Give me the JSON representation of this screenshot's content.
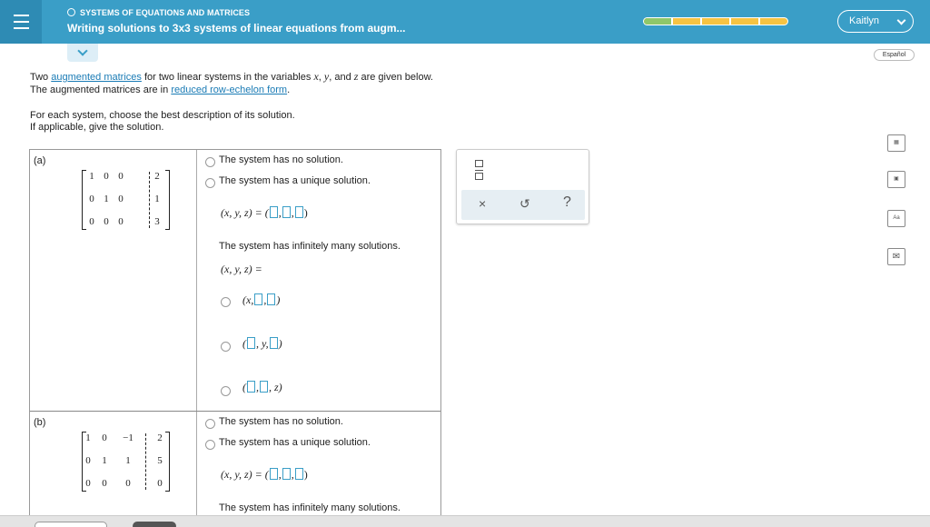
{
  "header": {
    "topic": "SYSTEMS OF EQUATIONS AND MATRICES",
    "title": "Writing solutions to 3x3 systems of linear equations from augm...",
    "user": "Kaitlyn",
    "progress_fraction": 0.2,
    "language": "Español"
  },
  "intro": {
    "l1_a": "Two ",
    "l1_link": "augmented matrices",
    "l1_b": " for two linear systems in the variables ",
    "var_x": "x",
    "comma1": ", ",
    "var_y": "y",
    "l1_c": ", and ",
    "var_z": "z",
    "l1_d": " are given below.",
    "l2_a": "The augmented matrices are in ",
    "l2_link": "reduced row-echelon form",
    "l2_b": ".",
    "l3": "For each system, choose the best description of its solution.",
    "l4": "If applicable, give the solution."
  },
  "part_a": {
    "label": "(a)",
    "matrix": [
      [
        "1",
        "0",
        "0",
        "2"
      ],
      [
        "0",
        "1",
        "0",
        "1"
      ],
      [
        "0",
        "0",
        "0",
        "3"
      ]
    ],
    "opt_none": "The system has no solution.",
    "opt_unique": "The system has a unique solution.",
    "unique_lhs": "(x, y, z) = (",
    "opt_infinite": "The system has infinitely many solutions.",
    "infinite_lhs": "(x,  y,  z) =",
    "form1_a": "(x,",
    "form1_b": ")",
    "form2_a": "(",
    "form2_b": ", y,",
    "form2_c": ")",
    "form3_a": "(",
    "form3_b": ", z)"
  },
  "part_b": {
    "label": "(b)",
    "matrix": [
      [
        "1",
        "0",
        "−1",
        "2"
      ],
      [
        "0",
        "1",
        "1",
        "5"
      ],
      [
        "0",
        "0",
        "0",
        "0"
      ]
    ],
    "opt_none": "The system has no solution.",
    "opt_unique": "The system has a unique solution.",
    "unique_lhs": "(x, y, z) = (",
    "opt_infinite": "The system has infinitely many solutions."
  },
  "tools": {
    "clear": "×",
    "undo": "↺",
    "help": "?"
  },
  "icons": {
    "calculator": "calculator-icon",
    "book": "book-icon",
    "glossary": "Aa",
    "mail": "mail-icon"
  }
}
